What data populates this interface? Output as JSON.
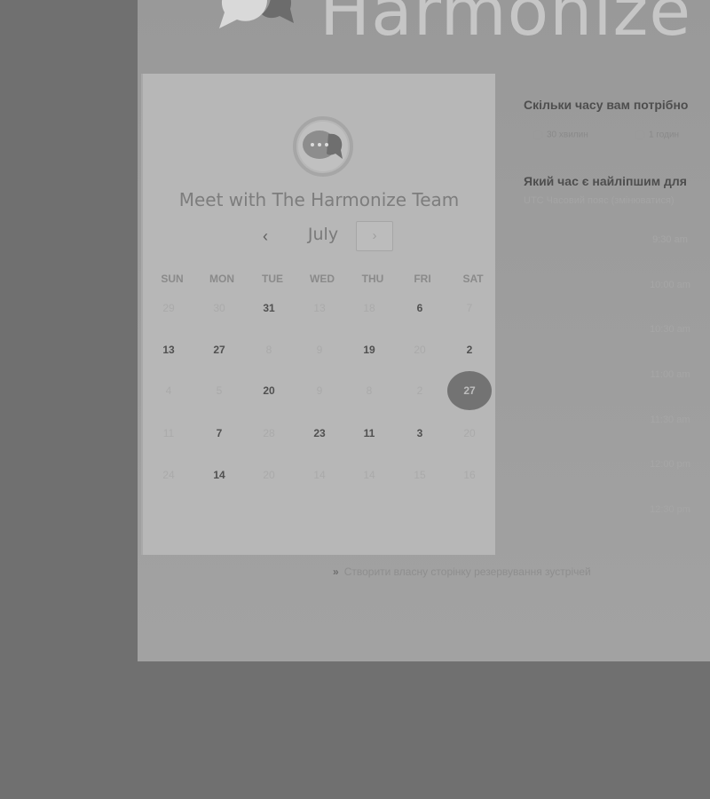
{
  "brand": {
    "name": "Harmonize",
    "logo_icon": "chat-bubble-logo"
  },
  "calendar": {
    "title": "Meet with The Harmonize Team",
    "month": "July",
    "prev_icon": "chevron-left-icon",
    "next_icon": "chevron-right-icon",
    "weekdays": [
      "SUN",
      "MON",
      "TUE",
      "WED",
      "THU",
      "FRI",
      "SAT"
    ],
    "weeks": [
      [
        {
          "label": "29",
          "available": false
        },
        {
          "label": "30",
          "available": false
        },
        {
          "label": "31",
          "available": true
        },
        {
          "label": "13",
          "available": false
        },
        {
          "label": "18",
          "available": false
        },
        {
          "label": "6",
          "available": true
        },
        {
          "label": "7",
          "available": false
        }
      ],
      [
        {
          "label": "13",
          "available": true
        },
        {
          "label": "27",
          "available": true
        },
        {
          "label": "8",
          "available": false
        },
        {
          "label": "9",
          "available": false
        },
        {
          "label": "19",
          "available": true
        },
        {
          "label": "20",
          "available": false
        },
        {
          "label": "2",
          "available": true
        }
      ],
      [
        {
          "label": "4",
          "available": false
        },
        {
          "label": "5",
          "available": false
        },
        {
          "label": "20",
          "available": true
        },
        {
          "label": "9",
          "available": false
        },
        {
          "label": "8",
          "available": false
        },
        {
          "label": "2",
          "available": false
        },
        {
          "label": "27",
          "available": true,
          "selected": true
        }
      ],
      [
        {
          "label": "11",
          "available": false
        },
        {
          "label": "7",
          "available": true
        },
        {
          "label": "28",
          "available": false
        },
        {
          "label": "23",
          "available": true
        },
        {
          "label": "11",
          "available": true
        },
        {
          "label": "3",
          "available": true
        },
        {
          "label": "20",
          "available": false
        }
      ],
      [
        {
          "label": "24",
          "available": false
        },
        {
          "label": "14",
          "available": true
        },
        {
          "label": "20",
          "available": false
        },
        {
          "label": "14",
          "available": false
        },
        {
          "label": "14",
          "available": false
        },
        {
          "label": "15",
          "available": false
        },
        {
          "label": "16",
          "available": false
        }
      ]
    ]
  },
  "booking": {
    "duration_question": "Скільки часу вам потрібно",
    "durations": [
      "30 хвилин",
      "1 годин"
    ],
    "time_question": "Який час є найліпшим для",
    "timezone_note": "UTC Часовий пояс (змінюватися)",
    "slots": [
      "9:30 am",
      "10:00 am",
      "10:30 am",
      "11:00 am",
      "11:30 am",
      "12:00 pm",
      "12:30 pm"
    ]
  },
  "footer": {
    "link_text": "Створити власну сторінку резервування зустрічей"
  },
  "colors": {
    "selected_day": "#737373",
    "background": "#707070"
  }
}
